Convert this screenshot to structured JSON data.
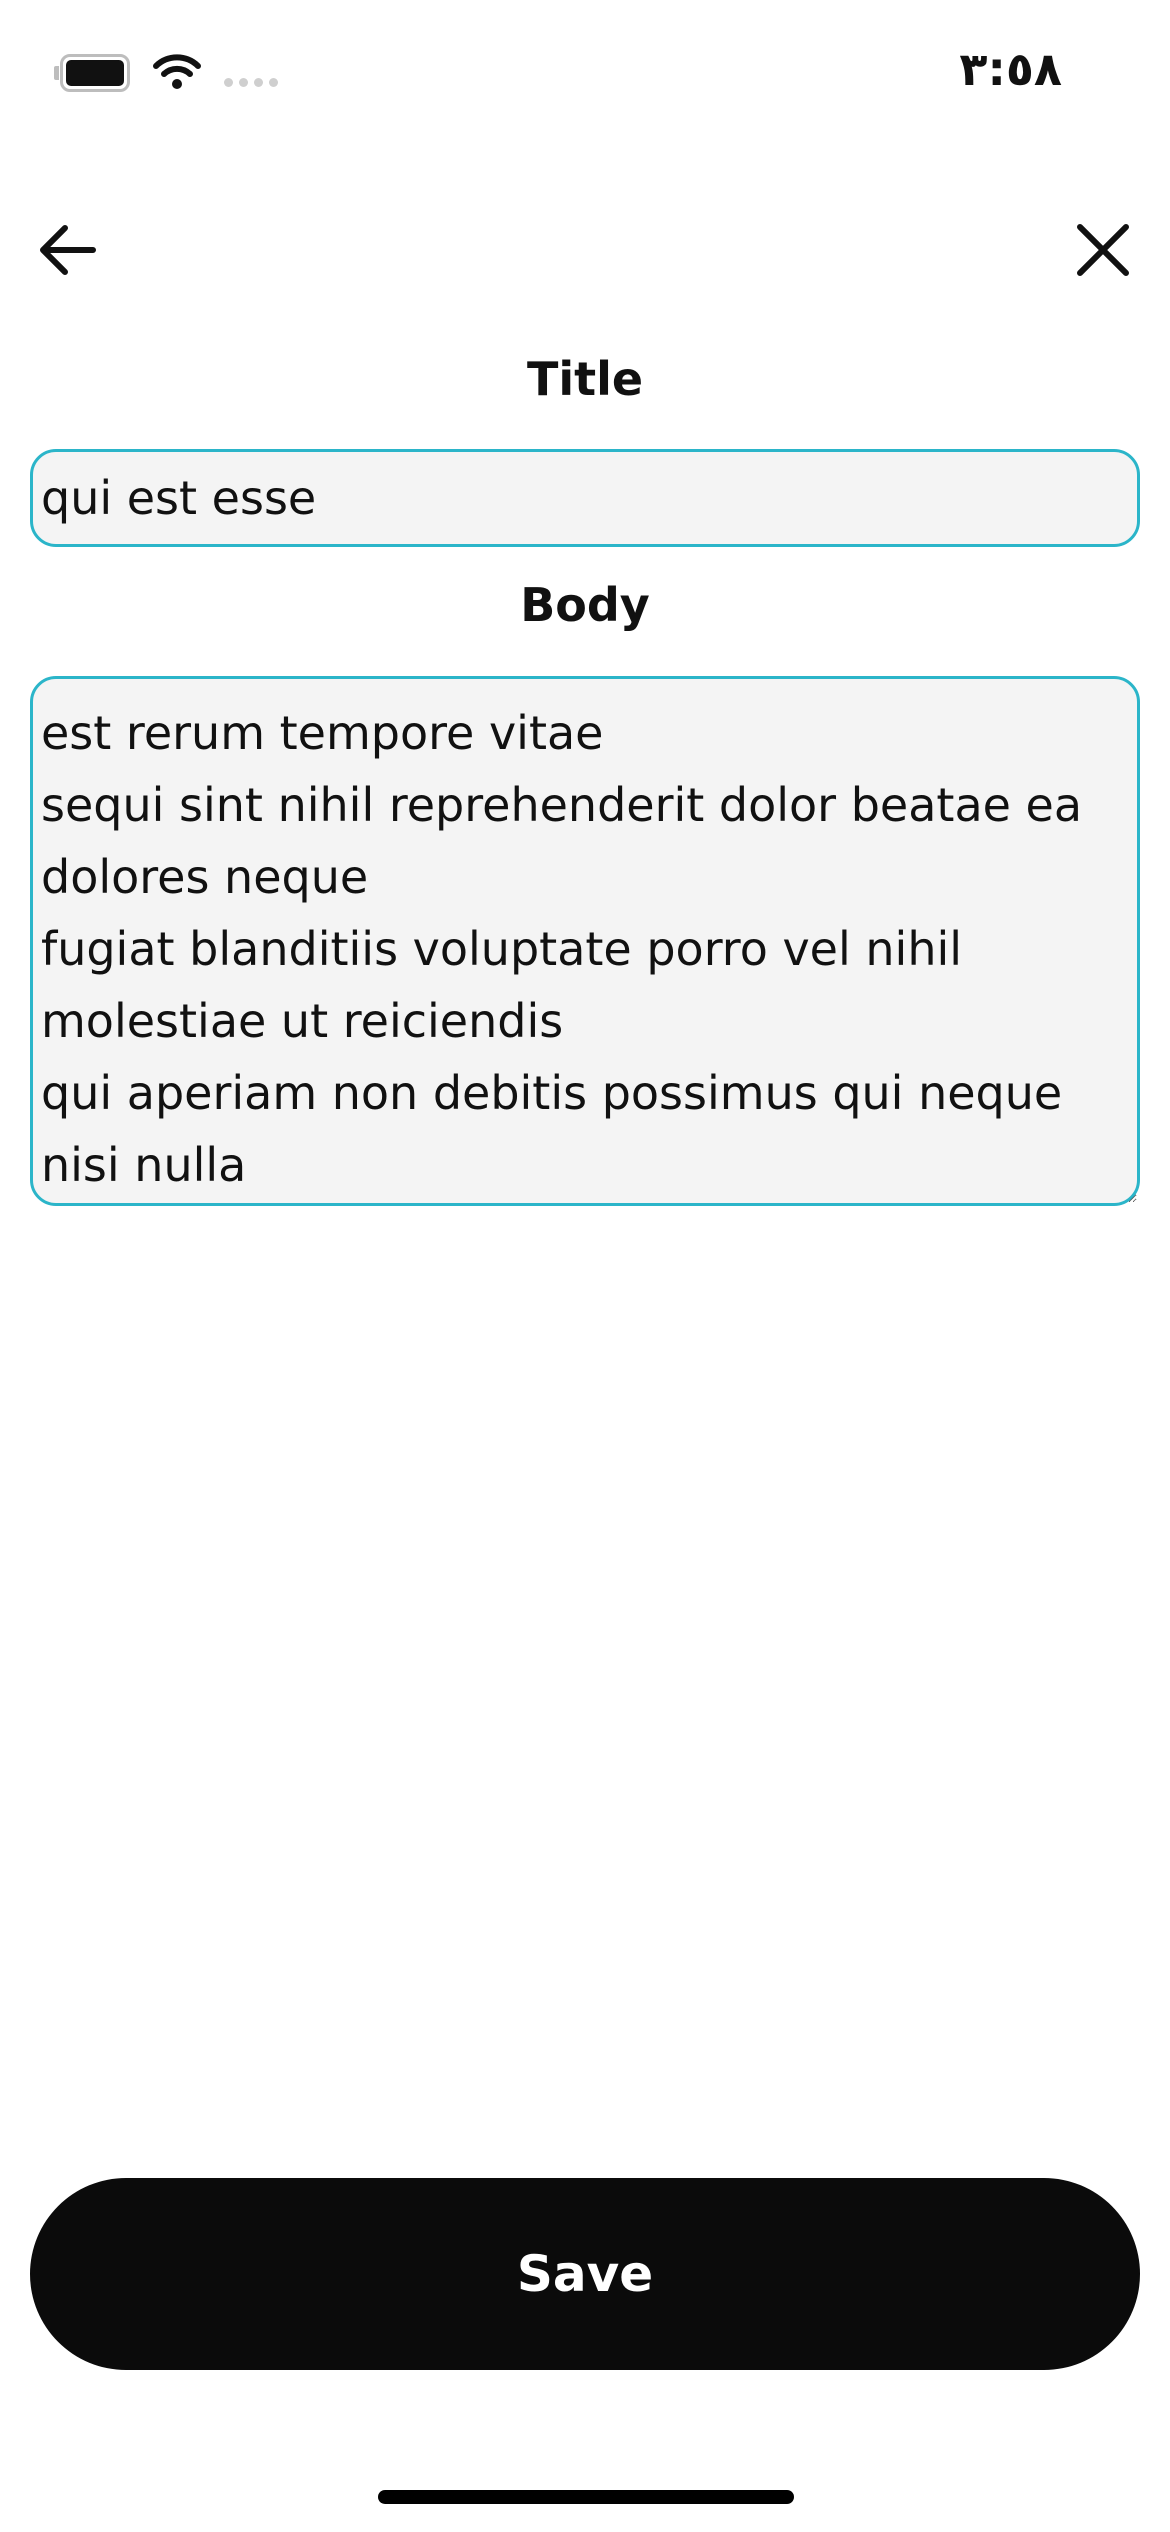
{
  "status_bar": {
    "time": "٣:٥٨",
    "icons": [
      "battery-icon",
      "wifi-icon",
      "cellular-signal-icon"
    ]
  },
  "nav": {
    "back_icon": "arrow-left-icon",
    "close_icon": "close-icon"
  },
  "form": {
    "title_label": "Title",
    "title_value": "qui est esse",
    "body_label": "Body",
    "body_value": "est rerum tempore vitae\nsequi sint nihil reprehenderit dolor beatae ea\ndolores neque\nfugiat blanditiis voluptate porro vel nihil\nmolestiae ut reiciendis\nqui aperiam non debitis possimus qui neque\nnisi nulla"
  },
  "actions": {
    "save_label": "Save"
  },
  "colors": {
    "accent_border": "#2bb5c9",
    "field_background": "#f4f4f4",
    "button_background": "#0b0b0b",
    "button_text": "#ffffff"
  }
}
